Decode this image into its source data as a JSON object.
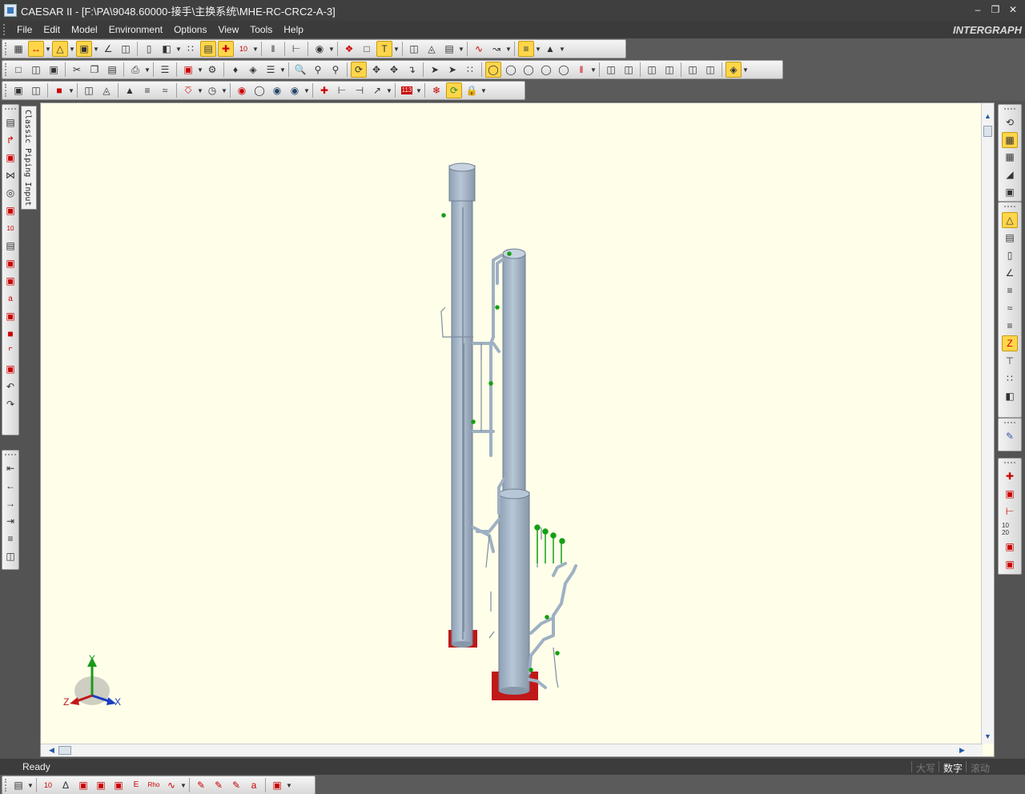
{
  "window": {
    "title": "CAESAR II - [F:\\PA\\9048.60000-接手\\主换系统\\MHE-RC-CRC2-A-3]",
    "controls": [
      "minimize-icon",
      "restore-icon",
      "close-icon"
    ]
  },
  "menu": {
    "items": [
      "File",
      "Edit",
      "Model",
      "Environment",
      "Options",
      "View",
      "Tools",
      "Help"
    ]
  },
  "brand": "INTERGRAPH",
  "side_tab": {
    "label": "Classic Piping Input"
  },
  "viewport": {
    "background": "#fefee9",
    "axes": {
      "y": "Y",
      "z": "Z",
      "x": "X"
    },
    "colors": {
      "pipe": "#aab8c8",
      "anchor": "#c01818",
      "restraint": "#14a014"
    }
  },
  "status": {
    "text": "Ready",
    "indicators": [
      {
        "label": "大写",
        "active": false
      },
      {
        "label": "数字",
        "active": true
      },
      {
        "label": "滚动",
        "active": false
      }
    ]
  }
}
